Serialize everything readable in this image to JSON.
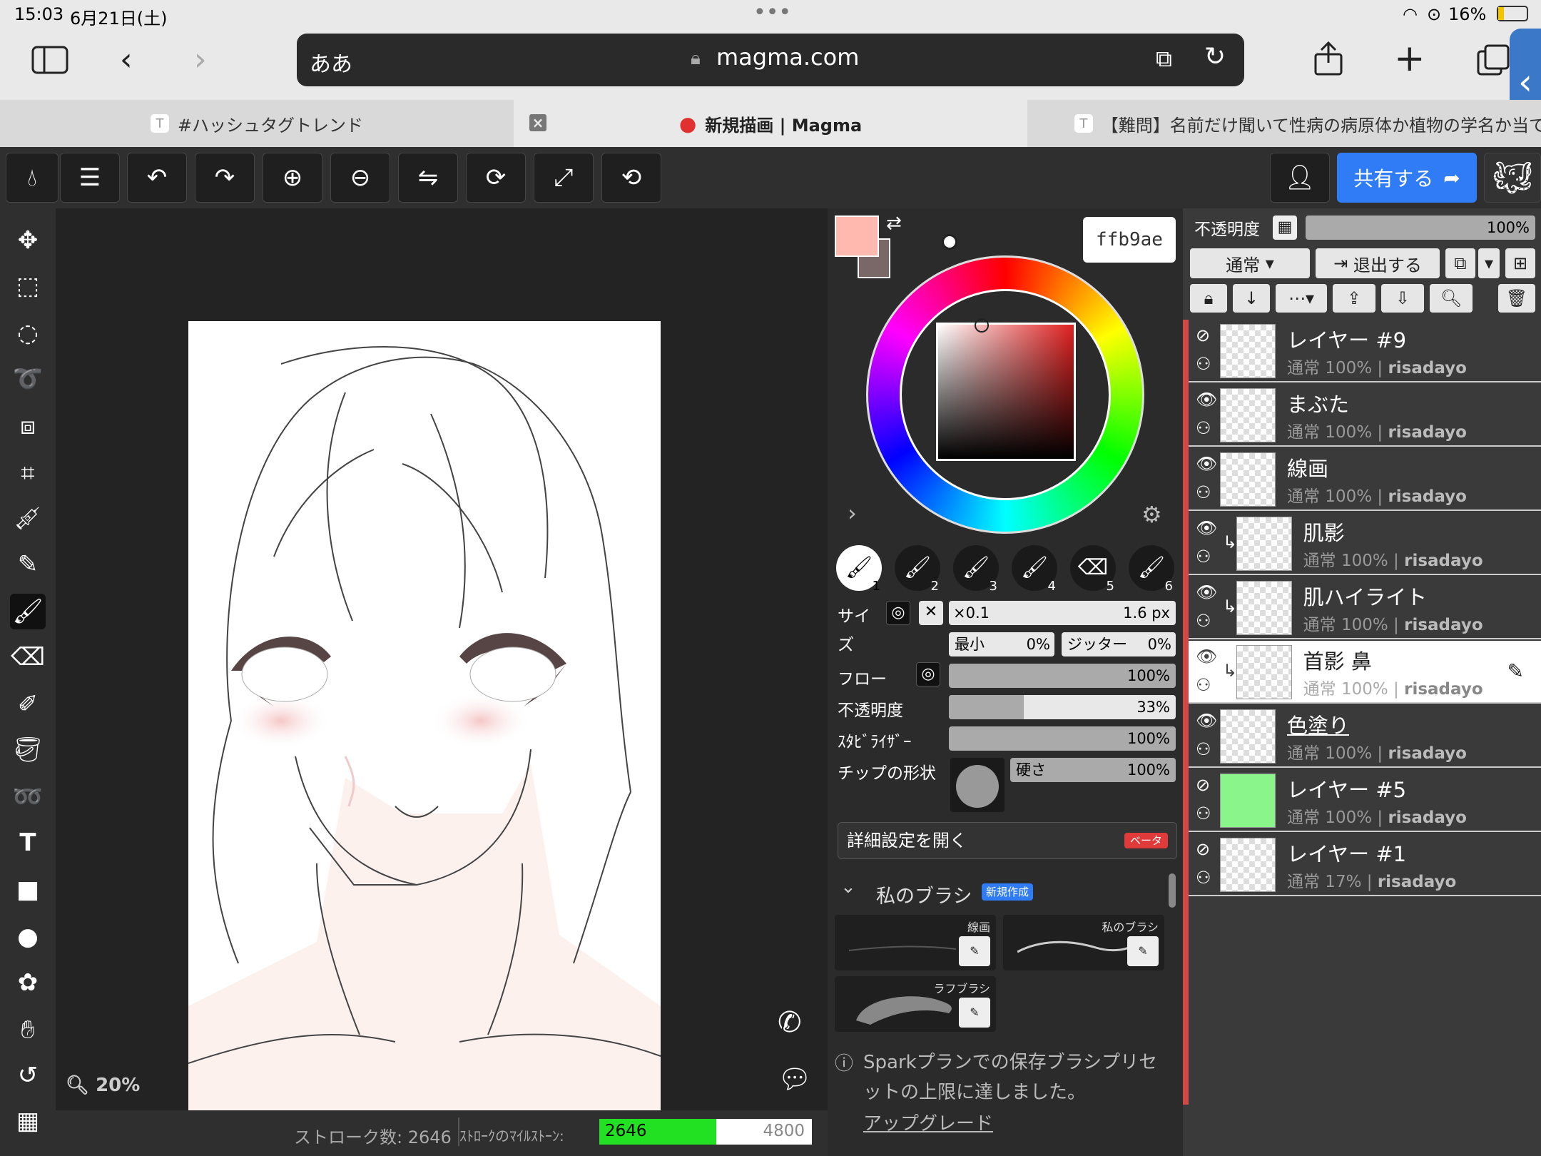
{
  "status": {
    "time": "15:03",
    "date": "6月21日(土)",
    "battery": "16%"
  },
  "browser": {
    "search_text": "ああ",
    "url": "magma.com"
  },
  "tabs": [
    {
      "label": "#ハッシュタグトレンド",
      "icon": "T"
    },
    {
      "label": "新規描画 | Magma"
    },
    {
      "label": "【難問】名前だけ聞いて性病の病原体か植物の学名か当て",
      "icon": "T"
    }
  ],
  "toolbar": {
    "share_label": "共有する"
  },
  "canvas": {
    "zoom": "20%"
  },
  "bottom": {
    "stroke_label": "ストローク数: 2646",
    "milestone_label": "ｽﾄﾛｰｸのﾏｲﾙｽﾄｰﾝ:",
    "milestone_current": "2646",
    "milestone_max": "4800",
    "milestone_progress": 0.551
  },
  "color": {
    "hex": "ffb9ae",
    "primary": "#ffb9ae",
    "secondary": "#7a6868"
  },
  "brushes": [
    "1",
    "2",
    "3",
    "4",
    "5",
    "6"
  ],
  "brush_settings": {
    "size_label_1": "サイ",
    "size_label_2": "ズ",
    "size_mult": "×0.1",
    "size_value": "1.6 px",
    "min_label": "最小",
    "min_value": "0%",
    "jitter_label": "ジッター",
    "jitter_value": "0%",
    "flow_label": "フロー",
    "flow_value": "100%",
    "opacity_label": "不透明度",
    "opacity_value": "33%",
    "opacity_fraction": 0.33,
    "stabilizer_label": "ｽﾀﾋﾞﾗｲｻﾞｰ",
    "stabilizer_value": "100%",
    "tip_label": "チップの形状",
    "hardness_label": "硬さ",
    "hardness_value": "100%",
    "details_label": "詳細設定を開く",
    "beta_label": "ベータ"
  },
  "my_brushes": {
    "title": "私のブラシ",
    "new_label": "新規作成",
    "items": [
      "線画",
      "私のブラシ",
      "ラフブラシ"
    ],
    "notice": "Sparkプランでの保存ブラシプリセットの上限に達しました。",
    "upgrade": "アップグレード"
  },
  "layer_panel": {
    "opacity_label": "不透明度",
    "opacity_value": "100%",
    "blend_label": "通常",
    "exit_label": "退出する"
  },
  "layers": [
    {
      "name": "レイヤー #9",
      "sub": "通常 100%",
      "user": "risadayo",
      "visible": false
    },
    {
      "name": "まぶた",
      "sub": "通常 100%",
      "user": "risadayo",
      "visible": true
    },
    {
      "name": "線画",
      "sub": "通常 100%",
      "user": "risadayo",
      "visible": true
    },
    {
      "name": "肌影",
      "sub": "通常 100%",
      "user": "risadayo",
      "visible": true
    },
    {
      "name": "肌ハイライト",
      "sub": "通常 100%",
      "user": "risadayo",
      "visible": true
    },
    {
      "name": "首影 鼻",
      "sub": "通常 100%",
      "user": "risadayo",
      "visible": true
    },
    {
      "name": "色塗り",
      "sub": "通常 100%",
      "user": "risadayo",
      "visible": true
    },
    {
      "name": "レイヤー #5",
      "sub": "通常 100%",
      "user": "risadayo",
      "visible": false
    },
    {
      "name": "レイヤー #1",
      "sub": "通常 17%",
      "user": "risadayo",
      "visible": false
    }
  ]
}
